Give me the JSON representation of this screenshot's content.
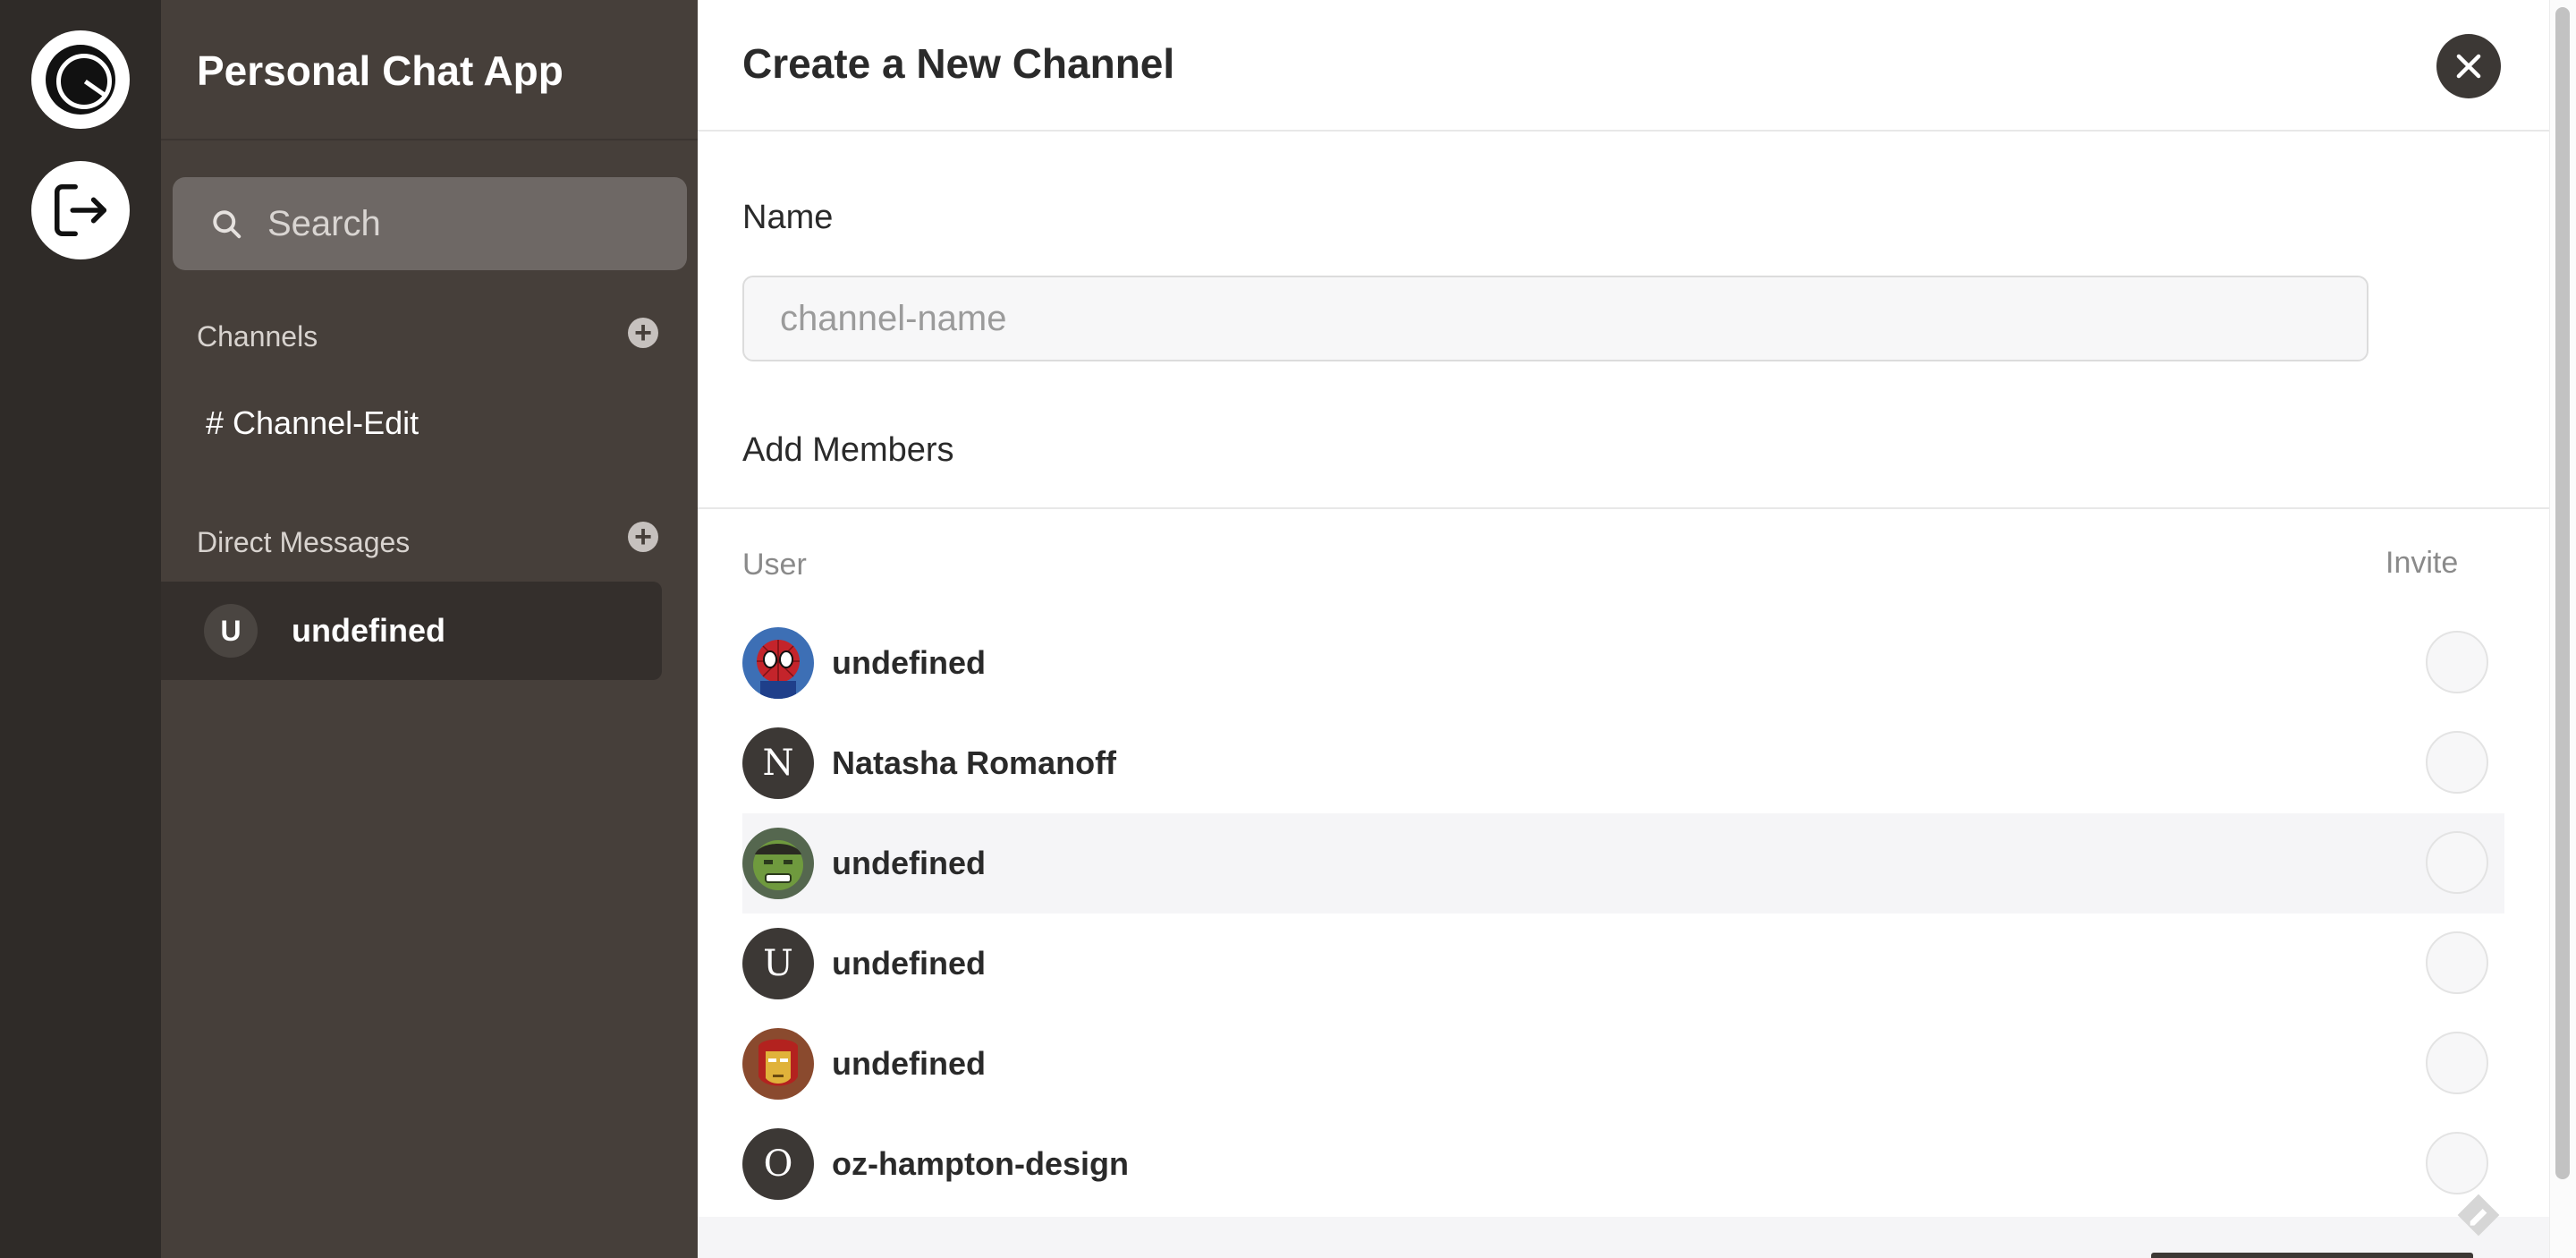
{
  "rail": {
    "logo_icon": "brand-logo-icon",
    "logout_icon": "logout-icon"
  },
  "sidebar": {
    "app_title": "Personal Chat App",
    "search_placeholder": "Search",
    "channels_label": "Channels",
    "channels": [
      "# Channel-Edit"
    ],
    "direct_messages_label": "Direct Messages",
    "direct_messages": [
      {
        "initial": "U",
        "name": "undefined"
      }
    ]
  },
  "modal": {
    "title": "Create a New Channel",
    "name_label": "Name",
    "name_placeholder": "channel-name",
    "name_value": "",
    "add_members_label": "Add Members",
    "columns": {
      "user": "User",
      "invite": "Invite"
    },
    "users": [
      {
        "name": "undefined",
        "avatar": "spiderman-photo"
      },
      {
        "name": "Natasha Romanoff",
        "avatar": "letter",
        "initial": "N"
      },
      {
        "name": "undefined",
        "avatar": "hulk-photo"
      },
      {
        "name": "undefined",
        "avatar": "letter",
        "initial": "U"
      },
      {
        "name": "undefined",
        "avatar": "ironman-photo"
      },
      {
        "name": "oz-hampton-design",
        "avatar": "letter",
        "initial": "O"
      }
    ]
  },
  "colors": {
    "rail_bg": "#2f2b28",
    "sidebar_bg": "#463f3a",
    "accent_dark": "#3c3835",
    "highlight_row": "#f5f5f7"
  }
}
